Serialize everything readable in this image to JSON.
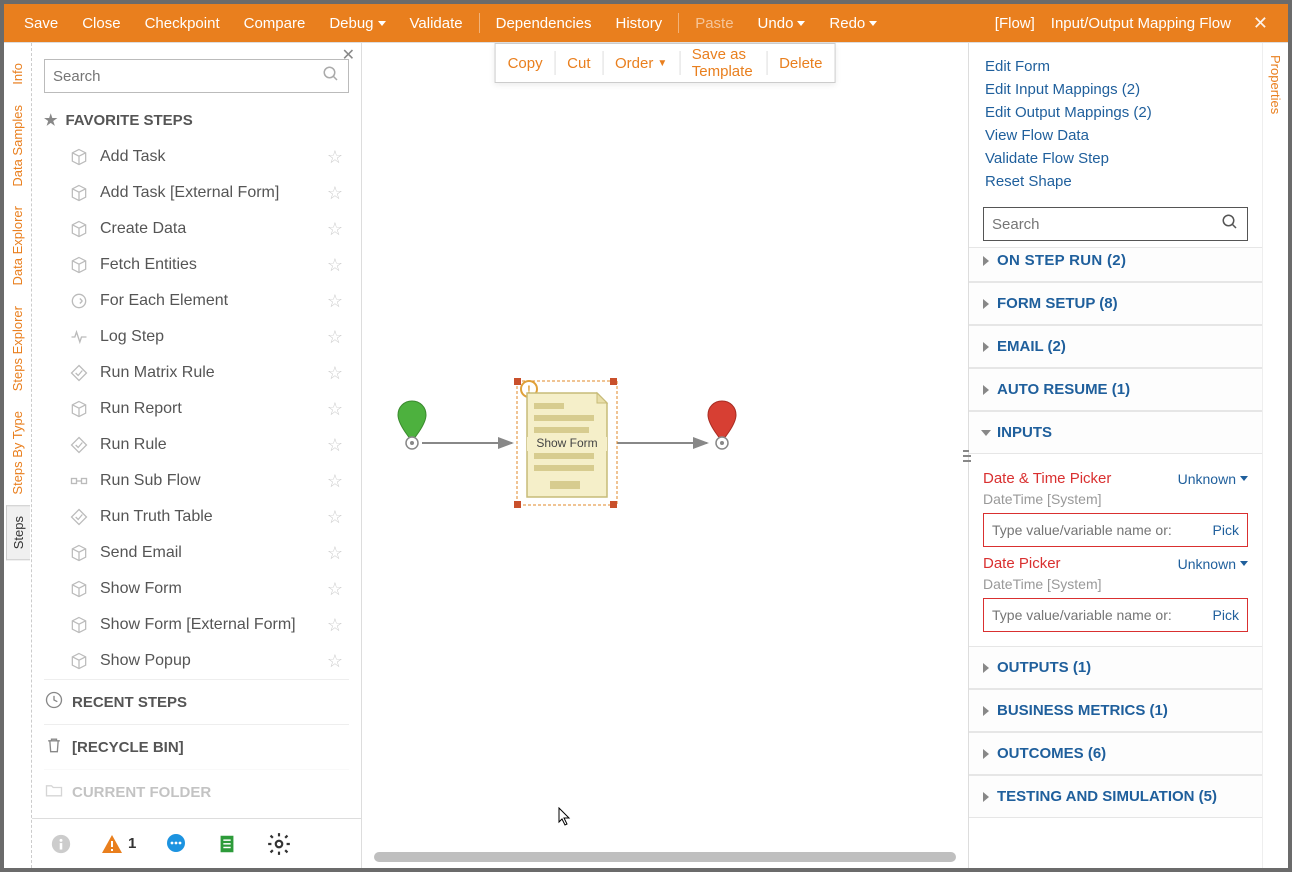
{
  "toolbar": {
    "save": "Save",
    "close": "Close",
    "checkpoint": "Checkpoint",
    "compare": "Compare",
    "debug": "Debug",
    "validate": "Validate",
    "dependencies": "Dependencies",
    "history": "History",
    "paste": "Paste",
    "undo": "Undo",
    "redo": "Redo",
    "context": "[Flow]",
    "title": "Input/Output Mapping Flow"
  },
  "left_tabs": [
    "Info",
    "Data Samples",
    "Data Explorer",
    "Steps Explorer",
    "Steps By Type",
    "Steps"
  ],
  "search_placeholder": "Search",
  "favorite_heading": "FAVORITE STEPS",
  "favorite_steps": [
    "Add Task",
    "Add Task [External Form]",
    "Create Data",
    "Fetch Entities",
    "For Each Element",
    "Log Step",
    "Run Matrix Rule",
    "Run Report",
    "Run Rule",
    "Run Sub Flow",
    "Run Truth Table",
    "Send Email",
    "Show Form",
    "Show Form [External Form]",
    "Show Popup"
  ],
  "recent_heading": "RECENT STEPS",
  "recycle_heading": "[RECYCLE BIN]",
  "current_folder_heading": "CURRENT FOLDER",
  "tray_warning_count": "1",
  "floating_bar": {
    "copy": "Copy",
    "cut": "Cut",
    "order": "Order",
    "save_template": "Save as Template",
    "delete": "Delete"
  },
  "canvas_node_label": "Show Form",
  "right_tab": "Properties",
  "right_links": [
    "Edit Form",
    "Edit Input Mappings  (2)",
    "Edit Output Mappings  (2)",
    "View Flow Data",
    "Validate Flow Step",
    "Reset Shape"
  ],
  "right_search_placeholder": "Search",
  "sections": {
    "on_step_run_cut": "ON STEP RUN  (2)",
    "form_setup": "FORM SETUP (8)",
    "email": "EMAIL (2)",
    "auto_resume": "AUTO RESUME (1)",
    "inputs": "INPUTS",
    "outputs": "OUTPUTS (1)",
    "business": "BUSINESS METRICS (1)",
    "outcomes": "OUTCOMES (6)",
    "testing": "TESTING AND SIMULATION (5)"
  },
  "inputs_fields": [
    {
      "label": "Date & Time Picker",
      "status": "Unknown",
      "type": "DateTime [System]",
      "placeholder": "Type value/variable name or:",
      "pick": "Pick"
    },
    {
      "label": "Date Picker",
      "status": "Unknown",
      "type": "DateTime [System]",
      "placeholder": "Type value/variable name or:",
      "pick": "Pick"
    }
  ]
}
